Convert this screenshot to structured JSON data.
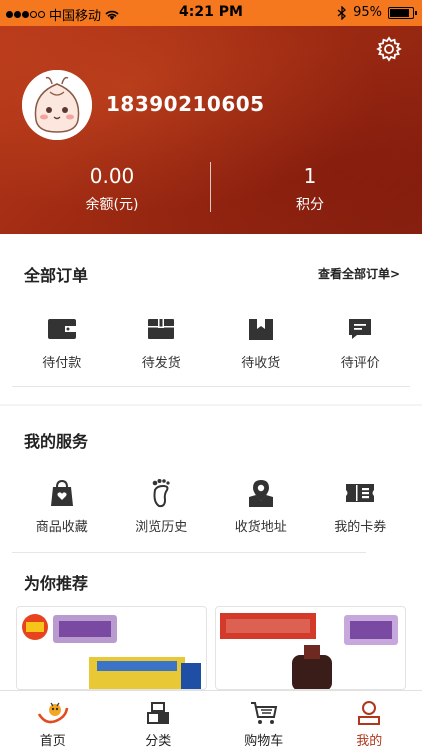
{
  "status_bar": {
    "carrier": "中国移动",
    "time": "4:21 PM",
    "battery": "95%",
    "battery_level": 0.95
  },
  "profile": {
    "phone": "18390210605"
  },
  "stats": [
    {
      "value": "0.00",
      "label": "余额(元)"
    },
    {
      "value": "1",
      "label": "积分"
    }
  ],
  "orders": {
    "title": "全部订单",
    "view_all": "查看全部订单>",
    "items": [
      {
        "label": "待付款",
        "icon": "wallet-icon"
      },
      {
        "label": "待发货",
        "icon": "box-icon"
      },
      {
        "label": "待收货",
        "icon": "package-icon"
      },
      {
        "label": "待评价",
        "icon": "comment-icon"
      }
    ]
  },
  "services": {
    "title": "我的服务",
    "items": [
      {
        "label": "商品收藏",
        "icon": "heart-bag-icon"
      },
      {
        "label": "浏览历史",
        "icon": "footprint-icon"
      },
      {
        "label": "收货地址",
        "icon": "location-map-icon"
      },
      {
        "label": "我的卡券",
        "icon": "ticket-icon"
      }
    ]
  },
  "recommend": {
    "title": "为你推荐"
  },
  "tabbar": {
    "items": [
      {
        "label": "首页",
        "icon": "home-logo-icon"
      },
      {
        "label": "分类",
        "icon": "category-icon"
      },
      {
        "label": "购物车",
        "icon": "cart-icon"
      },
      {
        "label": "我的",
        "icon": "user-icon",
        "active": true
      }
    ]
  },
  "colors": {
    "accent": "#f5781f",
    "header_red": "#9e2a12",
    "active_tab": "#b0371b"
  }
}
